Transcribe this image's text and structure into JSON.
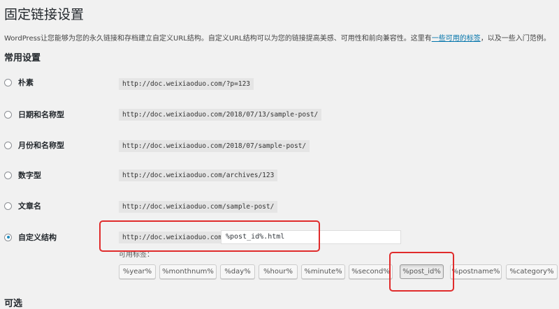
{
  "header": {
    "title": "固定链接设置",
    "intro_text": "WordPress让您能够为您的永久链接和存档建立自定义URL结构。自定义URL结构可以为您的链接提高美感、可用性和前向兼容性。这里有",
    "intro_link": "一些可用的标签",
    "intro_suffix": "，以及一些入门范例。"
  },
  "common": {
    "title": "常用设置",
    "options": [
      {
        "label": "朴素",
        "example": "http://doc.weixiaoduo.com/?p=123",
        "checked": false
      },
      {
        "label": "日期和名称型",
        "example": "http://doc.weixiaoduo.com/2018/07/13/sample-post/",
        "checked": false
      },
      {
        "label": "月份和名称型",
        "example": "http://doc.weixiaoduo.com/2018/07/sample-post/",
        "checked": false
      },
      {
        "label": "数字型",
        "example": "http://doc.weixiaoduo.com/archives/123",
        "checked": false
      },
      {
        "label": "文章名",
        "example": "http://doc.weixiaoduo.com/sample-post/",
        "checked": false
      },
      {
        "label": "自定义结构",
        "example": "http://doc.weixiaoduo.com",
        "checked": true
      }
    ],
    "custom_value": "%post_id%.html",
    "available_tags_label": "可用标签：",
    "tags": [
      "%year%",
      "%monthnum%",
      "%day%",
      "%hour%",
      "%minute%",
      "%second%",
      "%post_id%",
      "%postname%",
      "%category%"
    ],
    "active_tag": "%post_id%"
  },
  "optional": {
    "title": "可选"
  },
  "colors": {
    "link": "#0073aa",
    "highlight": "#e02b2b",
    "radio_checked": "#1e8cbe"
  }
}
